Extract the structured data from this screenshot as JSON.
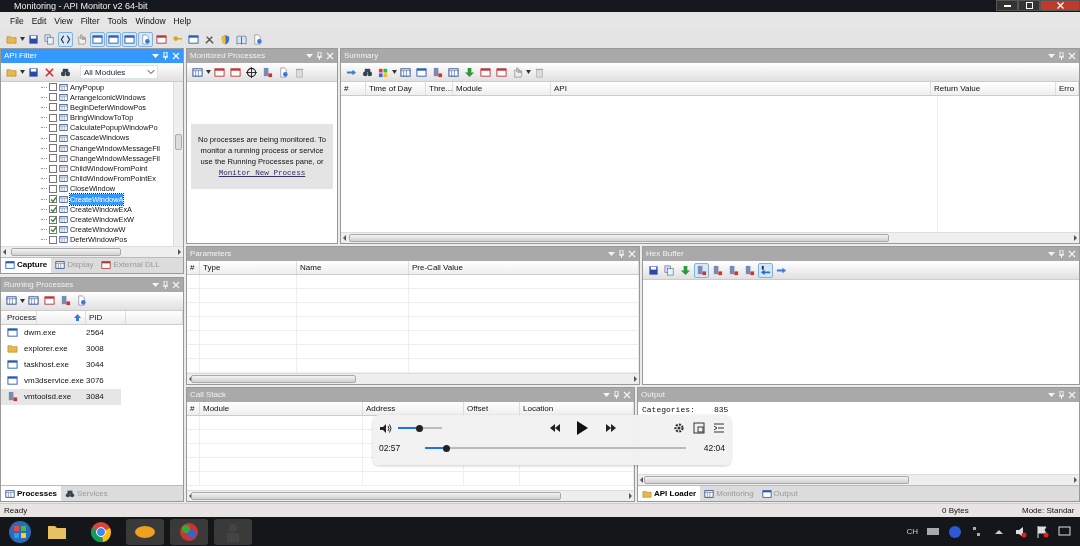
{
  "window": {
    "title": "Monitoring - API Monitor v2 64-bit"
  },
  "menu": [
    "File",
    "Edit",
    "View",
    "Filter",
    "Tools",
    "Window",
    "Help"
  ],
  "main_toolbar": [
    {
      "pressed": false
    },
    {
      "pressed": false
    },
    {
      "pressed": false
    },
    {
      "pressed": true
    },
    {
      "pressed": false
    },
    {
      "pressed": true
    },
    {
      "pressed": true
    },
    {
      "pressed": true
    },
    {
      "pressed": true
    },
    {
      "pressed": false
    },
    {
      "pressed": false
    },
    {
      "pressed": false
    },
    {
      "pressed": false
    },
    {
      "pressed": false
    },
    {
      "pressed": false
    },
    {
      "pressed": false
    }
  ],
  "api_filter": {
    "title": "API Filter",
    "active": true,
    "module_select": "All Modules",
    "items": [
      {
        "label": "AnyPopup",
        "checked": false,
        "selected": false
      },
      {
        "label": "ArrangeIconicWindows",
        "checked": false,
        "selected": false
      },
      {
        "label": "BeginDeferWindowPos",
        "checked": false,
        "selected": false
      },
      {
        "label": "BringWindowToTop",
        "checked": false,
        "selected": false
      },
      {
        "label": "CalculatePopupWindowPo",
        "checked": false,
        "selected": false
      },
      {
        "label": "CascadeWindows",
        "checked": false,
        "selected": false
      },
      {
        "label": "ChangeWindowMessageFil",
        "checked": false,
        "selected": false
      },
      {
        "label": "ChangeWindowMessageFil",
        "checked": false,
        "selected": false
      },
      {
        "label": "ChildWindowFromPoint",
        "checked": false,
        "selected": false
      },
      {
        "label": "ChildWindowFromPointEx",
        "checked": false,
        "selected": false
      },
      {
        "label": "CloseWindow",
        "checked": false,
        "selected": false
      },
      {
        "label": "CreateWindowA",
        "checked": true,
        "selected": true
      },
      {
        "label": "CreateWindowExA",
        "checked": true,
        "selected": false
      },
      {
        "label": "CreateWindowExW",
        "checked": true,
        "selected": false
      },
      {
        "label": "CreateWindowW",
        "checked": true,
        "selected": false
      },
      {
        "label": "DeferWindowPos",
        "checked": false,
        "selected": false
      }
    ],
    "tabs": [
      {
        "label": "Capture",
        "selected": true
      },
      {
        "label": "Display",
        "selected": false
      },
      {
        "label": "External DLL",
        "selected": false
      }
    ]
  },
  "running_processes": {
    "title": "Running Processes",
    "active": false,
    "columns": [
      "Process",
      "PID"
    ],
    "rows": [
      {
        "name": "dwm.exe",
        "pid": "2564",
        "selected": false
      },
      {
        "name": "explorer.exe",
        "pid": "3008",
        "selected": false
      },
      {
        "name": "taskhost.exe",
        "pid": "3044",
        "selected": false
      },
      {
        "name": "vm3dservice.exe",
        "pid": "3076",
        "selected": false
      },
      {
        "name": "vmtoolsd.exe",
        "pid": "3084",
        "selected": true
      }
    ],
    "tabs": [
      {
        "label": "Processes",
        "selected": true
      },
      {
        "label": "Services",
        "selected": false
      }
    ]
  },
  "monitored_processes": {
    "title": "Monitored Processes",
    "active": false,
    "message": "No processes are being monitored. To monitor a running process or service use the Running Processes pane, or",
    "link": "Monitor New Process"
  },
  "summary": {
    "title": "Summary",
    "active": false,
    "columns": [
      "#",
      "Time of Day",
      "Thre...",
      "Module",
      "API",
      "Return Value",
      "Erro"
    ]
  },
  "parameters": {
    "title": "Parameters",
    "active": false,
    "columns": [
      "#",
      "Type",
      "Name",
      "Pre-Call Value"
    ]
  },
  "hex_buffer": {
    "title": "Hex Buffer",
    "active": false
  },
  "call_stack": {
    "title": "Call Stack",
    "active": false,
    "columns": [
      "#",
      "Module",
      "Address",
      "Offset",
      "Location"
    ]
  },
  "output": {
    "title": "Output",
    "active": false,
    "lines": [
      {
        "key": "Categories:",
        "value": "835"
      }
    ],
    "tabs": [
      {
        "label": "API Loader",
        "selected": true
      },
      {
        "label": "Monitoring",
        "selected": false
      },
      {
        "label": "Output",
        "selected": false
      }
    ]
  },
  "video_player": {
    "volume": {
      "level": 0.48
    },
    "current_time": "02:57",
    "progress": {
      "level": 0.08
    },
    "duration": "42:04"
  },
  "status_bar": {
    "left": "Ready",
    "bytes": "0 Bytes",
    "mode": "Mode: Standar"
  },
  "taskbar": {
    "tray_text": "CH"
  }
}
